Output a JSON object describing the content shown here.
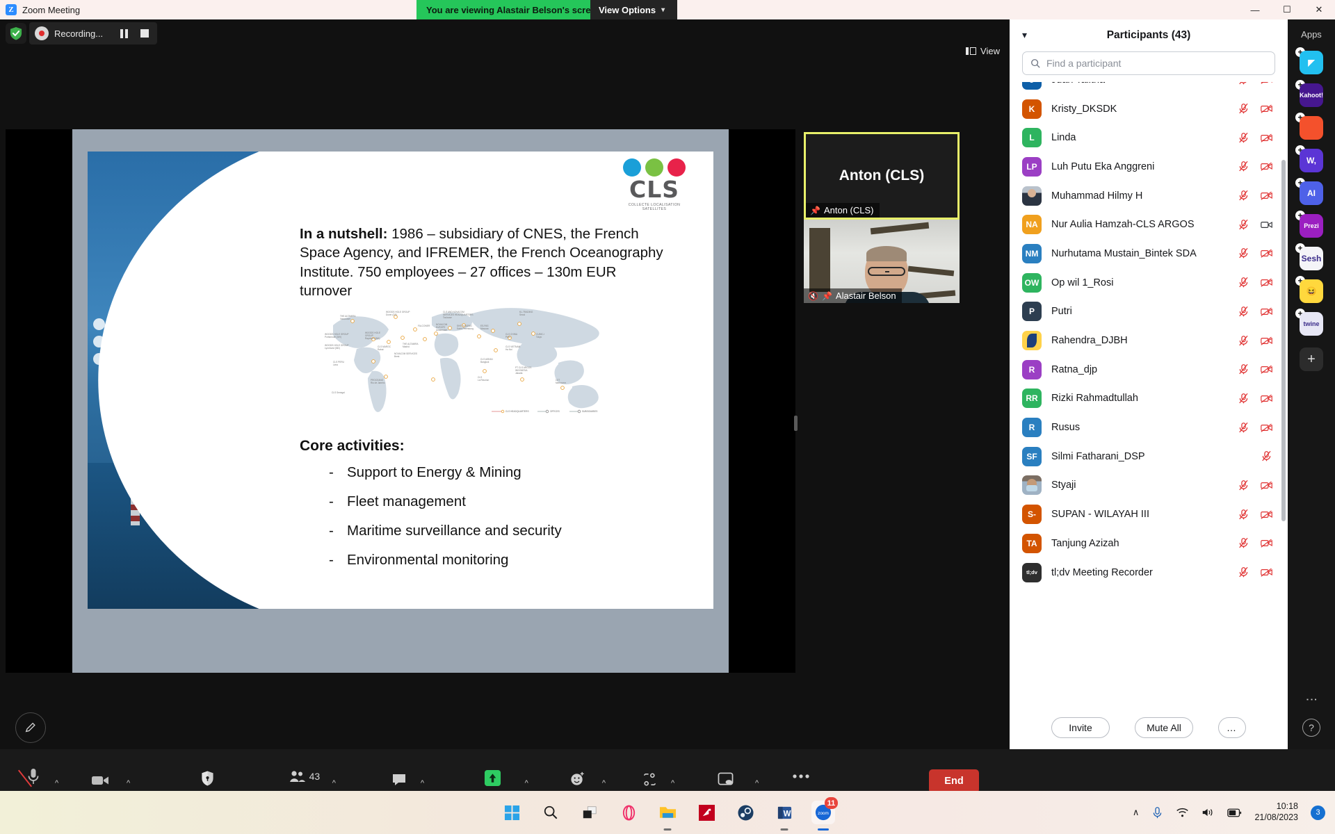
{
  "titlebar": {
    "app_title": "Zoom Meeting",
    "app_icon": "zoom-logo-icon",
    "logo_letter": "Z",
    "share_banner": "You are viewing Alastair Belson's screen",
    "view_options": "View Options",
    "minimize": "—",
    "maximize": "☐",
    "close": "✕"
  },
  "meeting": {
    "recording_label": "Recording...",
    "view_label": "View",
    "pause_icon": "pause-icon",
    "stop_icon": "stop-icon",
    "shield_icon": "security-shield-icon",
    "record_icon": "record-dot-icon"
  },
  "slide": {
    "logo": {
      "word": "CLS",
      "tagline": "COLLECTE LOCALISATION SATELLITES",
      "circle_colors": [
        "#1a9fd8",
        "#7ac143",
        "#e8224a"
      ]
    },
    "nutshell_label": "In a nutshell:",
    "nutshell_text": " 1986 – subsidiary of CNES, the French Space Agency, and IFREMER, the French Oceanography Institute. 750 employees – 27 offices – 130m EUR turnover",
    "core_title": "Core activities:",
    "core_items": [
      "Support to Energy & Mining",
      "Fleet management",
      "Maritime surveillance and security",
      "Environmental monitoring"
    ],
    "map_legend": [
      "CLS HEADQUARTERS",
      "OFFICES",
      "SUBSIDIARIES"
    ],
    "map_labels": [
      "THE ALTAMIRA Vancouver",
      "WOODS HOLE GROUP Dover (DE)",
      "CLS AND NOVACOM SERVICES HEADQUARTERS Toulouse",
      "KL-TRADING Seoul",
      "WOODS HOLE GROUP Portsmouth (NH)",
      "WOODS HOLE GROUP Raynham (MA)",
      "FALCONER",
      "NOVACOM EUROPE Amsterdam",
      "SHS TRADING Saint-Petersburg",
      "ES-PAS Moscow",
      "CLS CHINA Pekin",
      "CUBIC-I Tokyo",
      "WOODS HOLE GROUP Lynnhurst (MD)",
      "CLS MAROC Rabat",
      "THE ALTAMIRA Madrid",
      "NOVACOM SERVICES Brest",
      "CLS VIETNAM Ha Noi",
      "CLS PERU Lima",
      "CLS ASEAN Bangkok",
      "PT CLS ARGOS INDONESIA Jakarta",
      "PROCEANO Rio de Janeiro",
      "CLS Chile La Reunion",
      "LOT Melbourne",
      "CLS Senegal"
    ]
  },
  "thumbnails": [
    {
      "name": "Anton (CLS)",
      "center_label": "Anton (CLS)",
      "pinned": true,
      "active_speaker": true,
      "muted": false,
      "video_on": false
    },
    {
      "name": "Alastair Belson",
      "center_label": "",
      "pinned": true,
      "active_speaker": false,
      "muted": true,
      "video_on": true
    }
  ],
  "toolbar": {
    "items": [
      {
        "label": "Unmute",
        "icon": "microphone-muted-icon",
        "has_caret": true
      },
      {
        "label": "Stop Video",
        "icon": "video-camera-icon",
        "has_caret": true
      },
      {
        "label": "Security",
        "icon": "shield-icon",
        "has_caret": false
      },
      {
        "label": "Participants",
        "icon": "participants-icon",
        "has_caret": true,
        "count": "43"
      },
      {
        "label": "Chat",
        "icon": "chat-bubble-icon",
        "has_caret": true
      },
      {
        "label": "Share Screen",
        "icon": "share-screen-icon",
        "has_caret": true,
        "green": true
      },
      {
        "label": "Reactions",
        "icon": "reactions-icon",
        "has_caret": true
      },
      {
        "label": "Apps",
        "icon": "apps-icon",
        "has_caret": true
      },
      {
        "label": "Whiteboards",
        "icon": "whiteboard-icon",
        "has_caret": true
      },
      {
        "label": "More",
        "icon": "more-dots-icon",
        "has_caret": false
      }
    ],
    "end_button": "End"
  },
  "panel": {
    "title": "Participants (43)",
    "search_placeholder": "Find a participant",
    "search_value": "",
    "invite": "Invite",
    "mute_all": "Mute All",
    "more": "…",
    "participants": [
      {
        "name": "Juan Talitha",
        "initials": "J",
        "color": "#0e5fa8",
        "muted": true,
        "video_off": true
      },
      {
        "name": "Kristy_DKSDK",
        "initials": "K",
        "color": "#d35400",
        "muted": true,
        "video_off": true
      },
      {
        "name": "Linda",
        "initials": "L",
        "color": "#2eb45f",
        "muted": true,
        "video_off": true
      },
      {
        "name": "Luh Putu Eka Anggreni",
        "initials": "LP",
        "color": "#9b3fc4",
        "muted": true,
        "video_off": true
      },
      {
        "name": "Muhammad Hilmy H",
        "initials": "",
        "color": "#243a55",
        "photo": "p1",
        "muted": true,
        "video_off": true
      },
      {
        "name": "Nur Aulia Hamzah-CLS ARGOS",
        "initials": "NA",
        "color": "#f0a01e",
        "muted": true,
        "video_off": false
      },
      {
        "name": "Nurhutama Mustain_Bintek SDA",
        "initials": "NM",
        "color": "#2a7fc0",
        "muted": true,
        "video_off": true
      },
      {
        "name": "Op wil 1_Rosi",
        "initials": "OW",
        "color": "#2eb45f",
        "muted": true,
        "video_off": true
      },
      {
        "name": "Putri",
        "initials": "P",
        "color": "#2d3e50",
        "muted": true,
        "video_off": true
      },
      {
        "name": "Rahendra_DJBH",
        "initials": "",
        "color": "#ffd24a",
        "brand": "rahendra",
        "muted": true,
        "video_off": true
      },
      {
        "name": "Ratna_djp",
        "initials": "R",
        "color": "#9b3fc4",
        "muted": true,
        "video_off": true
      },
      {
        "name": "Rizki Rahmadtullah",
        "initials": "RR",
        "color": "#2eb45f",
        "muted": true,
        "video_off": true
      },
      {
        "name": "Rusus",
        "initials": "R",
        "color": "#2a7fc0",
        "muted": true,
        "video_off": true
      },
      {
        "name": "Silmi Fatharani_DSP",
        "initials": "SF",
        "color": "#2a7fc0",
        "muted": true,
        "video_off": null
      },
      {
        "name": "Styaji",
        "initials": "",
        "color": "#7b6e63",
        "photo": "p2",
        "muted": true,
        "video_off": true
      },
      {
        "name": "SUPAN - WILAYAH III",
        "initials": "S-",
        "color": "#d35400",
        "muted": true,
        "video_off": true
      },
      {
        "name": "Tanjung Azizah",
        "initials": "TA",
        "color": "#d35400",
        "muted": true,
        "video_off": true
      },
      {
        "name": "tl;dv Meeting Recorder",
        "initials": "tl;dv",
        "color": "#2e2e2e",
        "brand": "tldv",
        "muted": true,
        "video_off": true
      }
    ]
  },
  "rail": {
    "title": "Apps",
    "apps": [
      {
        "name": "figma-app-icon",
        "label": "",
        "bg": "#22c0f0",
        "glyph": "◤"
      },
      {
        "name": "kahoot-app-icon",
        "label": "Kahoot!",
        "bg": "#46178f",
        "glyph": ""
      },
      {
        "name": "puzzle-app-icon",
        "label": "",
        "bg": "#f4512c",
        "glyph": ""
      },
      {
        "name": "wordly-app-icon",
        "label": "W,",
        "bg": "#5b35d5",
        "glyph": ""
      },
      {
        "name": "ai-camera-app-icon",
        "label": "AI",
        "bg": "#4e61e8",
        "glyph": ""
      },
      {
        "name": "prezi-app-icon",
        "label": "Prezi",
        "bg": "#9b1fc1",
        "glyph": ""
      },
      {
        "name": "sesh-app-icon",
        "label": "Sesh",
        "bg": "#f4f4f8",
        "glyph": ""
      },
      {
        "name": "emoji-app-icon",
        "label": "",
        "bg": "#ffd83d",
        "glyph": "😆"
      },
      {
        "name": "twine-app-icon",
        "label": "twine",
        "bg": "#e7e7f5",
        "glyph": ""
      }
    ],
    "add_label": "+",
    "more_label": "⋮",
    "help_label": "?"
  },
  "taskbar": {
    "icons": [
      {
        "name": "windows-start-icon",
        "running": false
      },
      {
        "name": "search-icon",
        "running": false
      },
      {
        "name": "task-view-icon",
        "running": false
      },
      {
        "name": "opera-browser-icon",
        "running": false
      },
      {
        "name": "file-explorer-icon",
        "running": true
      },
      {
        "name": "amd-software-icon",
        "running": false
      },
      {
        "name": "steam-icon",
        "running": false
      },
      {
        "name": "microsoft-word-icon",
        "running": true
      },
      {
        "name": "zoom-taskbar-icon",
        "running": true,
        "badge": "11"
      }
    ],
    "tray": {
      "chevron": "∧",
      "mic_icon": "microphone-icon",
      "wifi_icon": "wifi-icon",
      "volume_icon": "speaker-icon",
      "battery_icon": "battery-icon",
      "time": "10:18",
      "date": "21/08/2023",
      "notification_count": "3"
    }
  }
}
